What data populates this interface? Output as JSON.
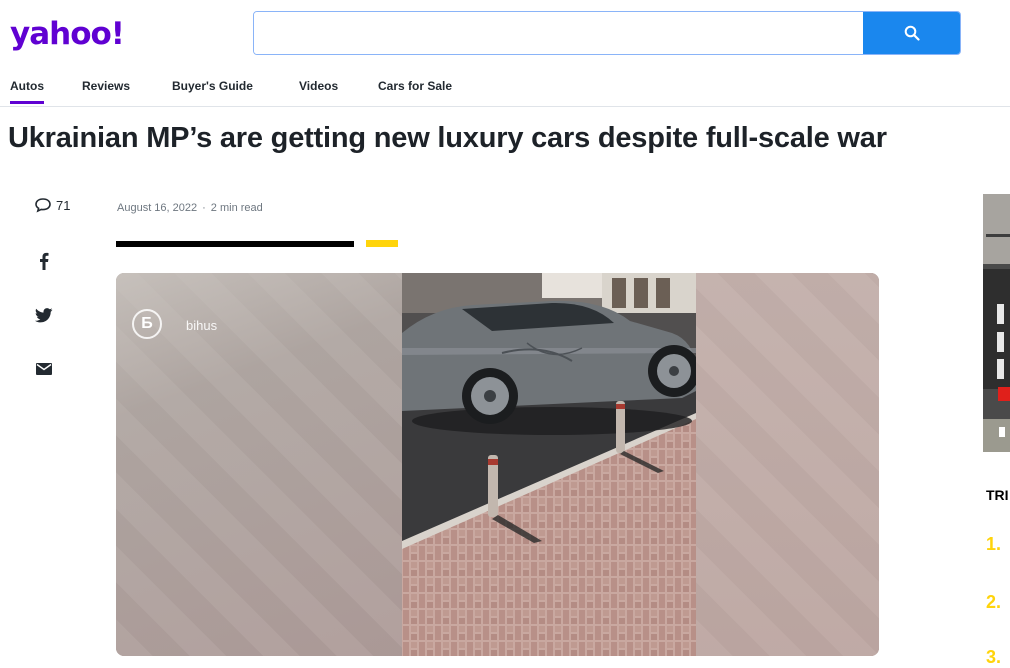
{
  "header": {
    "logo": "yahoo!",
    "search": {
      "value": "",
      "placeholder": ""
    },
    "search_icon": "search-icon"
  },
  "nav": {
    "items": [
      {
        "label": "Autos",
        "active": true
      },
      {
        "label": "Reviews"
      },
      {
        "label": "Buyer's Guide"
      },
      {
        "label": "Videos"
      },
      {
        "label": "Cars for Sale"
      }
    ]
  },
  "article": {
    "headline": "Ukrainian MP’s are getting new luxury cars despite full-scale war",
    "date": "August 16, 2022",
    "read_time": "2 min read",
    "separator": "·"
  },
  "social": {
    "comment_count": "71",
    "icons": [
      "comment-icon",
      "facebook-icon",
      "twitter-icon",
      "mail-icon"
    ]
  },
  "video": {
    "channel_logo": "Б",
    "channel_name": "bihus"
  },
  "sidebar": {
    "trending_label": "TRI",
    "ranks": [
      "1.",
      "2.",
      "3."
    ]
  },
  "colors": {
    "brand": "#6001d2",
    "search_button": "#1a87ee",
    "accent_yellow": "#ffd40b"
  }
}
